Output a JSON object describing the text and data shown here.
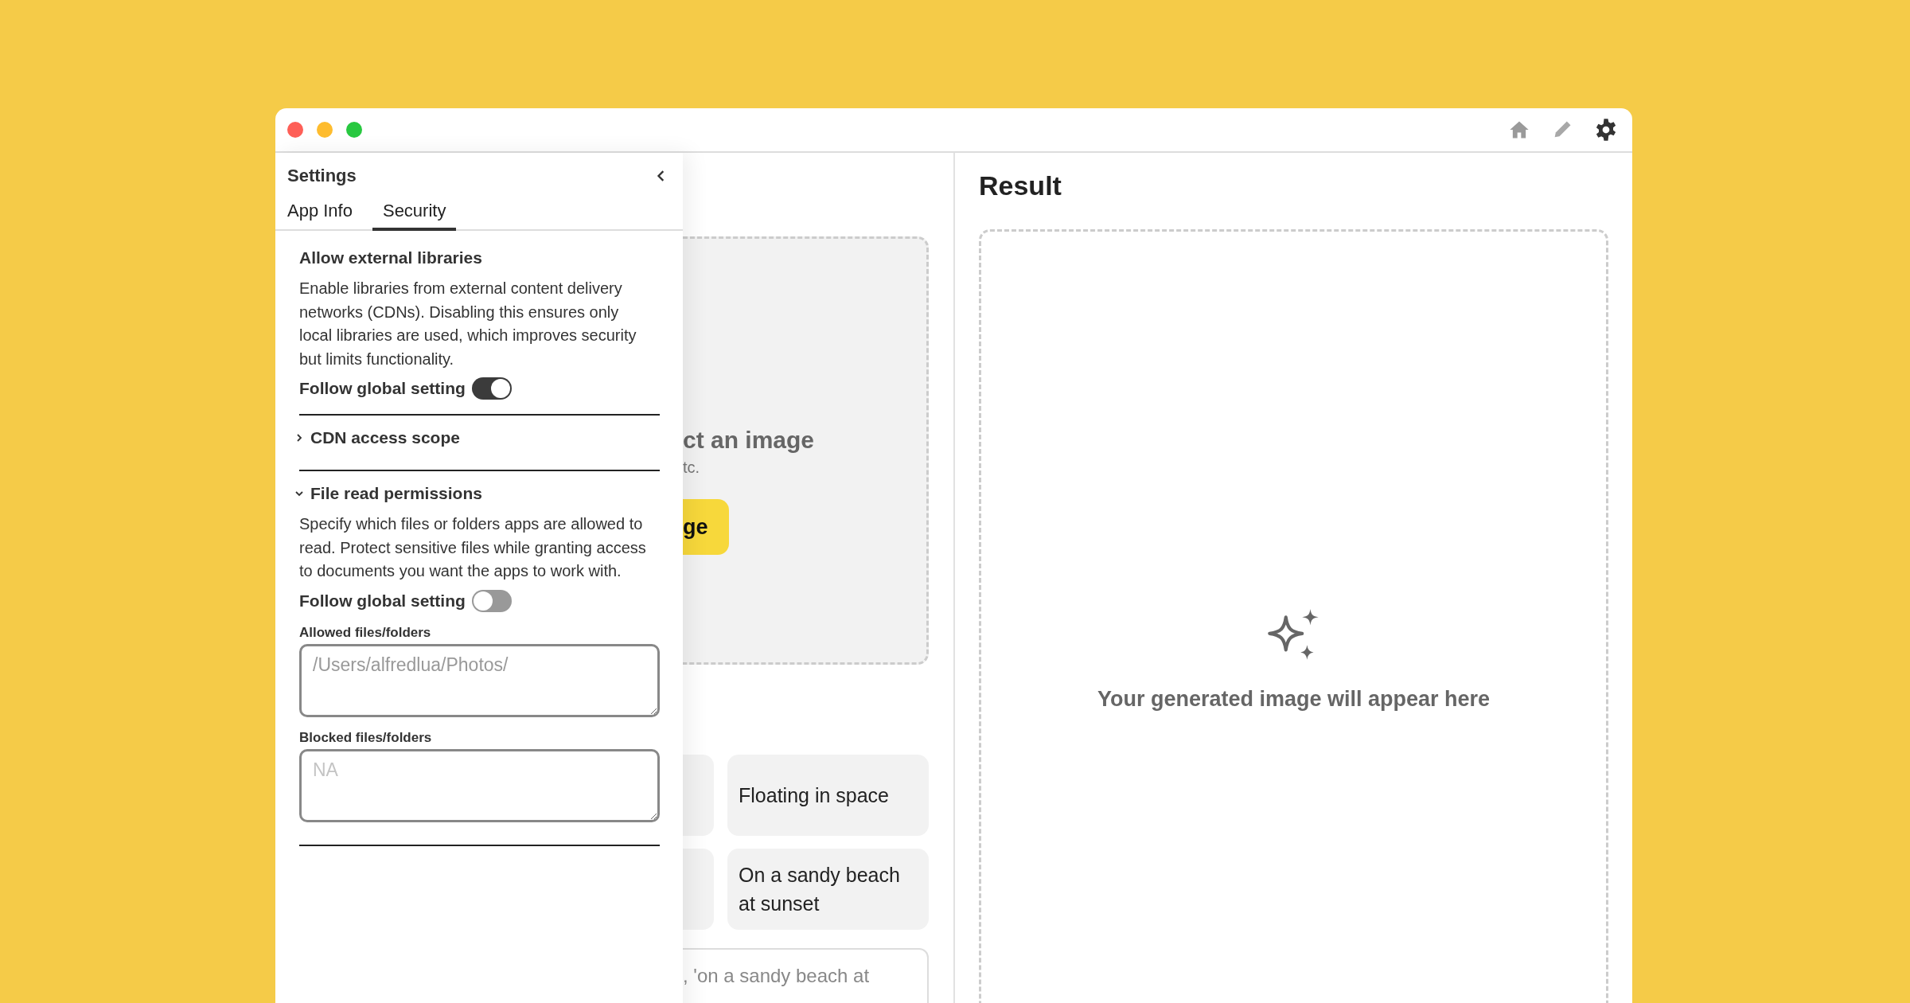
{
  "settings": {
    "title": "Settings",
    "tabs": [
      {
        "label": "App Info",
        "selected": false
      },
      {
        "label": "Security",
        "selected": true
      }
    ],
    "sections": [
      {
        "kind": "plain",
        "title": "Allow external libraries",
        "description": "Enable libraries from external content delivery networks (CDNs). Disabling this ensures only local libraries are used, which improves security but limits functionality.",
        "toggle": {
          "label": "Follow global setting",
          "on": true
        }
      },
      {
        "kind": "collapsible",
        "title": "CDN access scope",
        "expanded": false
      },
      {
        "kind": "collapsible",
        "title": "File read permissions",
        "expanded": true,
        "description": "Specify which files or folders apps are allowed to read. Protect sensitive files while granting access to documents you want the apps to work with.",
        "toggle": {
          "label": "Follow global setting",
          "on": false
        },
        "fields": [
          {
            "label": "Allowed files/folders",
            "placeholder": "/Users/alfredlua/Photos/"
          },
          {
            "label": "Blocked files/folders",
            "placeholder": "NA"
          }
        ]
      }
    ]
  },
  "upload": {
    "title": "ct an image",
    "hint": "tc.",
    "button": "ge"
  },
  "presets": [
    "Floating in space",
    "On a sandy beach at sunset"
  ],
  "prompt": {
    "placeholder": ", 'on a sandy beach at"
  },
  "result": {
    "title": "Result",
    "empty_text": "Your generated image will appear here"
  }
}
